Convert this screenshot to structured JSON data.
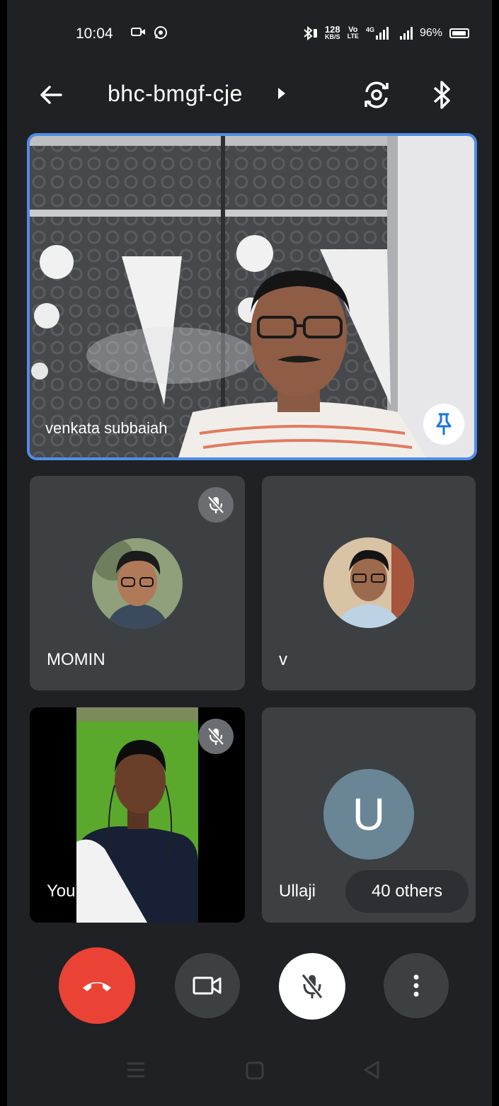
{
  "status_bar": {
    "time": "10:04",
    "data_rate_top": "128",
    "data_rate_bottom": "KB/S",
    "volte_top": "Vo",
    "volte_bottom": "LTE",
    "network_type": "4G",
    "battery": "96%"
  },
  "top_bar": {
    "meeting_code": "bhc-bmgf-cje",
    "icons": [
      "back-arrow-icon",
      "switch-camera-icon",
      "bluetooth-audio-icon"
    ]
  },
  "main_participant": {
    "name": "venkata subbaiah",
    "pinned": true,
    "highlight_color": "#4f8de8"
  },
  "tiles": [
    {
      "name": "MOMIN",
      "muted": true
    },
    {
      "name": "v",
      "muted": false
    },
    {
      "name": "You",
      "muted": true
    },
    {
      "name": "Ullaji",
      "initial": "U",
      "others_label": "40 others"
    }
  ],
  "controls": {
    "end_call_color": "#ea4335",
    "buttons": [
      "end-call",
      "camera-toggle",
      "mic-toggle",
      "more-options"
    ]
  },
  "colors": {
    "background": "#202124",
    "tile": "#3c4043",
    "initial_avatar": "#6a8595"
  }
}
